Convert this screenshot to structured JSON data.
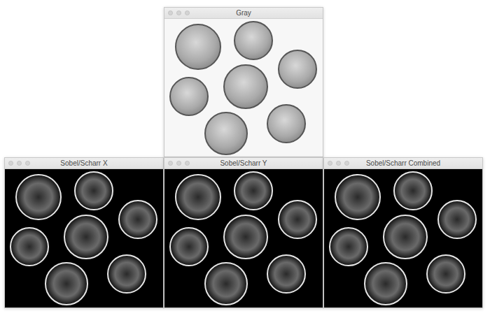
{
  "windows": [
    {
      "title": "Gray",
      "kind": "gray"
    },
    {
      "title": "Sobel/Scharr X",
      "kind": "edges"
    },
    {
      "title": "Sobel/Scharr Y",
      "kind": "edges"
    },
    {
      "title": "Sobel/Scharr Combined",
      "kind": "edges"
    }
  ]
}
